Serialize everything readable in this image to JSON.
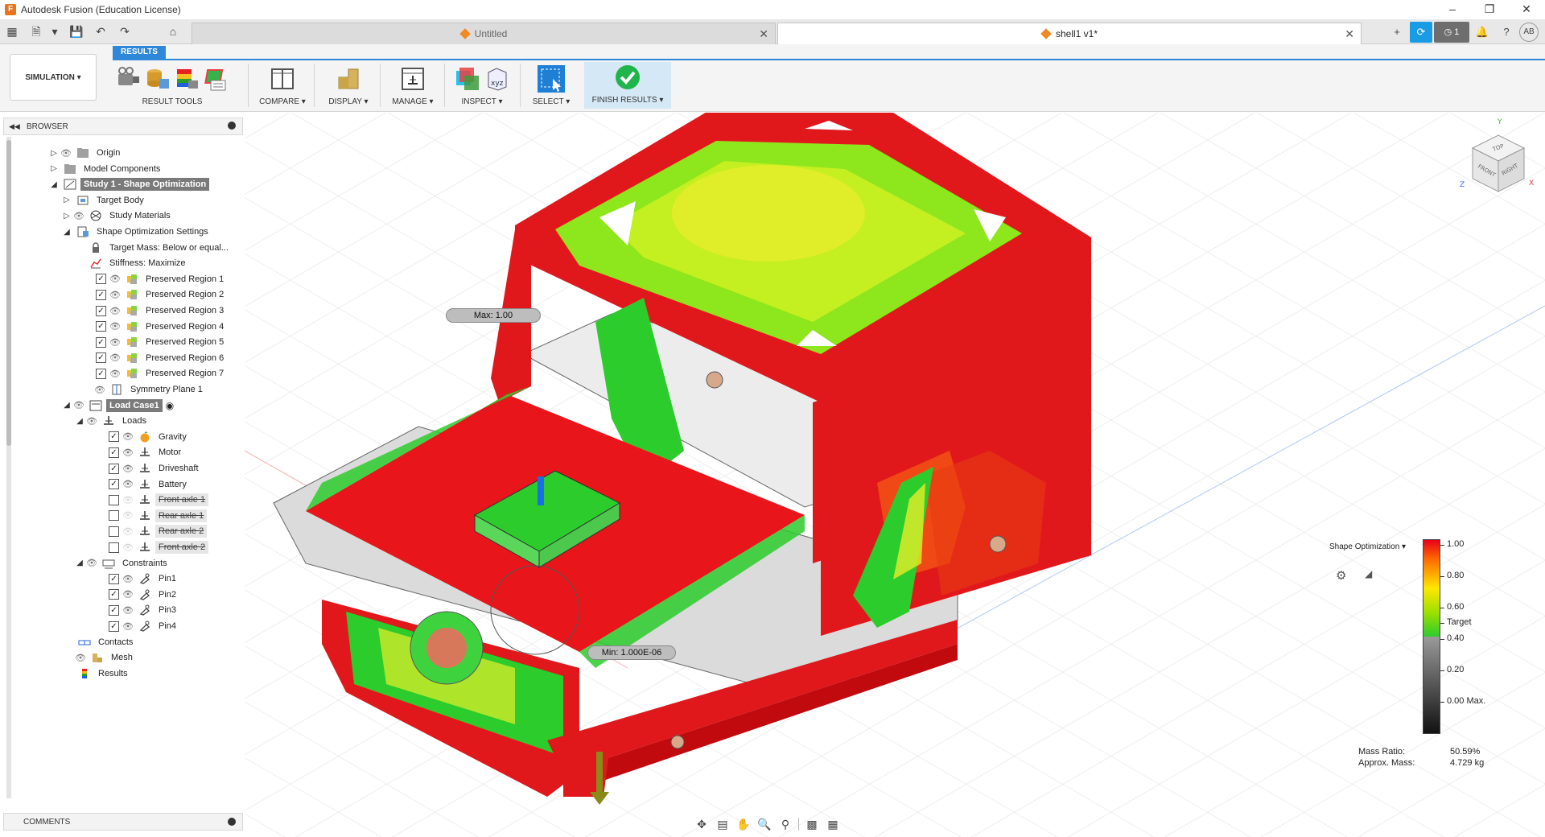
{
  "window": {
    "title": "Autodesk Fusion (Education License)"
  },
  "tabs": [
    {
      "label": "Untitled",
      "active": false
    },
    {
      "label": "shell1 v1*",
      "active": true
    }
  ],
  "tabbar_icons": {
    "job_count": "1",
    "user_initials": "AB"
  },
  "workspace": {
    "label": "SIMULATION"
  },
  "ribbon": {
    "active_tab": "RESULTS",
    "groups": [
      {
        "label": "RESULT TOOLS"
      },
      {
        "label": "COMPARE"
      },
      {
        "label": "DISPLAY"
      },
      {
        "label": "MANAGE"
      },
      {
        "label": "INSPECT"
      },
      {
        "label": "SELECT"
      },
      {
        "label": "FINISH RESULTS"
      }
    ]
  },
  "browser": {
    "title": "BROWSER",
    "items": [
      {
        "label": "Origin"
      },
      {
        "label": "Model Components"
      },
      {
        "label": "Study 1 - Shape Optimization"
      },
      {
        "label": "Target Body"
      },
      {
        "label": "Study Materials"
      },
      {
        "label": "Shape Optimization Settings"
      },
      {
        "label": "Target Mass: Below or equal..."
      },
      {
        "label": "Stiffness: Maximize"
      },
      {
        "label": "Preserved Region 1"
      },
      {
        "label": "Preserved Region 2"
      },
      {
        "label": "Preserved Region 3"
      },
      {
        "label": "Preserved Region 4"
      },
      {
        "label": "Preserved Region 5"
      },
      {
        "label": "Preserved Region 6"
      },
      {
        "label": "Preserved Region 7"
      },
      {
        "label": "Symmetry Plane 1"
      },
      {
        "label": "Load Case1"
      },
      {
        "label": "Loads"
      },
      {
        "label": "Gravity"
      },
      {
        "label": "Motor"
      },
      {
        "label": "Driveshaft"
      },
      {
        "label": "Battery"
      },
      {
        "label": "Front axle 1"
      },
      {
        "label": "Rear axle 1"
      },
      {
        "label": "Rear axle 2"
      },
      {
        "label": "Front axle 2"
      },
      {
        "label": "Constraints"
      },
      {
        "label": "Pin1"
      },
      {
        "label": "Pin2"
      },
      {
        "label": "Pin3"
      },
      {
        "label": "Pin4"
      },
      {
        "label": "Contacts"
      },
      {
        "label": "Mesh"
      },
      {
        "label": "Results"
      }
    ]
  },
  "comments": {
    "title": "COMMENTS"
  },
  "viewport": {
    "max_label": "Max: 1.00",
    "min_label": "Min: 1.000E-06"
  },
  "viewcube": {
    "top": "TOP",
    "front": "FRONT",
    "right": "RIGHT",
    "axis_x": "X",
    "axis_y": "Y",
    "axis_z": "Z"
  },
  "legend": {
    "title": "Shape Optimization",
    "ticks": [
      "1.00",
      "0.80",
      "0.60",
      "Target",
      "0.40",
      "0.20",
      "0.00 Max."
    ],
    "mass_ratio_label": "Mass Ratio:",
    "mass_ratio_value": "50.59%",
    "approx_mass_label": "Approx. Mass:",
    "approx_mass_value": "4.729 kg"
  },
  "colors": {
    "accent": "#2e87d8",
    "finish_green": "#1fb54a",
    "high": "#e8001a",
    "target": "#2ccc2c"
  }
}
